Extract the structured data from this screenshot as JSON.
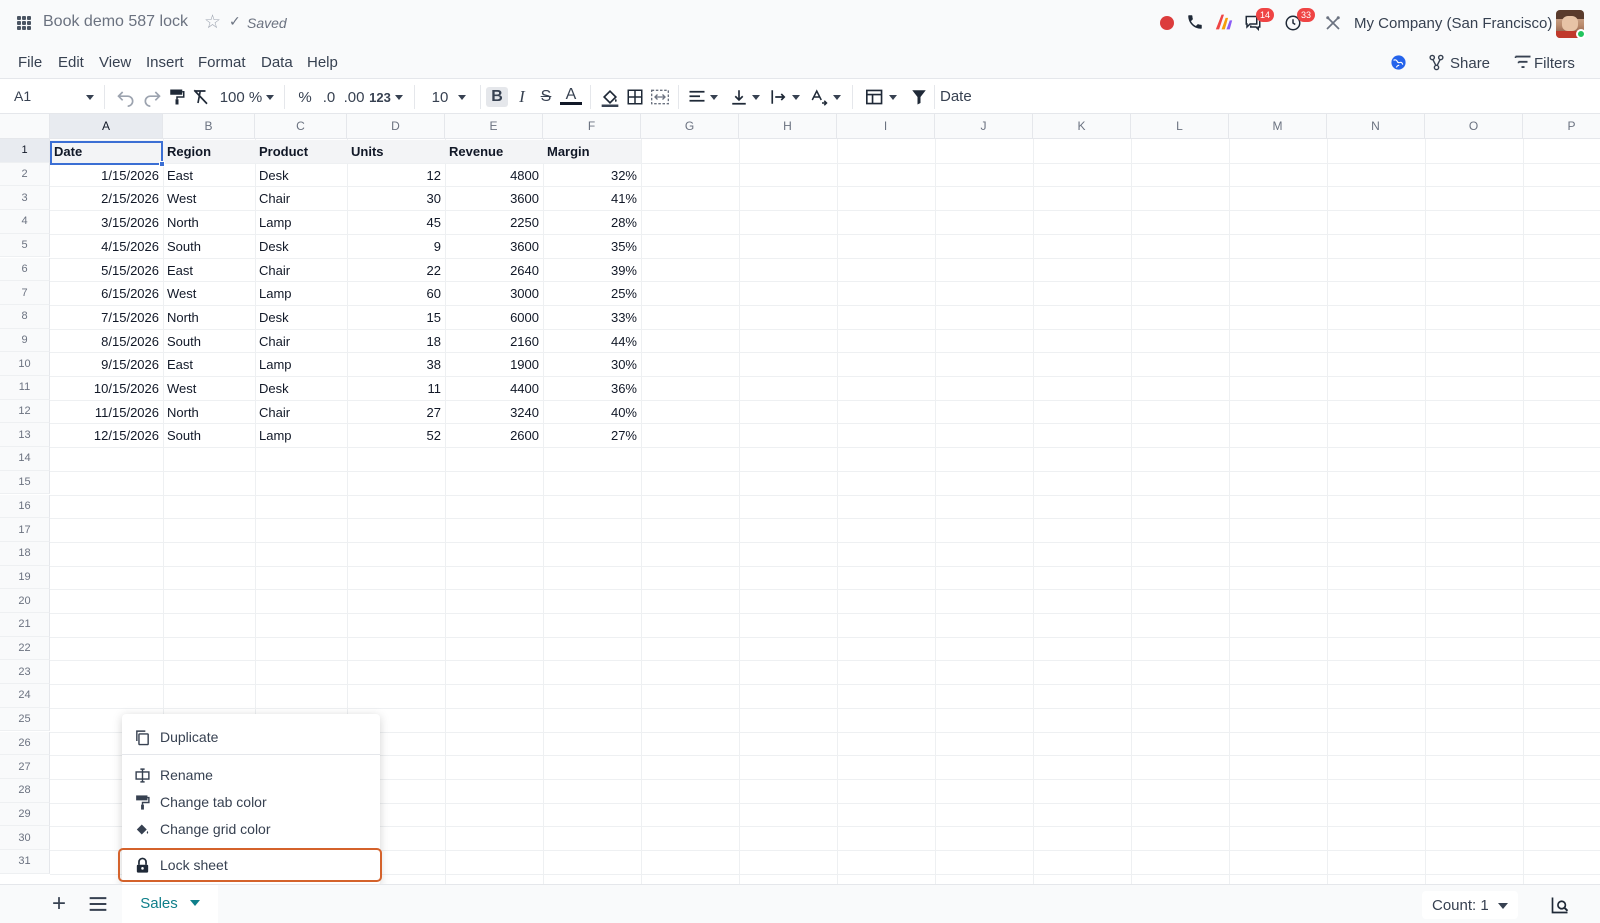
{
  "header": {
    "doc_title": "Book demo 587 lock",
    "saved_label": "Saved",
    "chat_badge": "14",
    "activity_badge": "33",
    "company_name": "My Company (San Francisco)"
  },
  "menus": [
    "File",
    "Edit",
    "View",
    "Insert",
    "Format",
    "Data",
    "Help"
  ],
  "actions": {
    "share_label": "Share",
    "filters_label": "Filters"
  },
  "toolbar": {
    "cell_ref": "A1",
    "zoom": "100 %",
    "percent_label": "%",
    "decrease_decimals_label": ".0",
    "increase_decimals_label": ".00",
    "number_format_label": "123",
    "font_size": "10",
    "bold_label": "B",
    "italic_label": "I",
    "strike_label": "S",
    "text_color_label": "A",
    "formula_value": "Date"
  },
  "grid": {
    "columns": [
      "A",
      "B",
      "C",
      "D",
      "E",
      "F",
      "G",
      "H",
      "I",
      "J",
      "K",
      "L",
      "M",
      "N",
      "O",
      "P"
    ],
    "row_numbers": [
      "1",
      "2",
      "3",
      "4",
      "5",
      "6",
      "7",
      "8",
      "9",
      "10",
      "11",
      "12",
      "13",
      "14",
      "15",
      "16",
      "17",
      "18",
      "19",
      "20",
      "21",
      "22",
      "23",
      "24",
      "25",
      "26",
      "27",
      "28",
      "29",
      "30",
      "31"
    ],
    "headers": [
      "Date",
      "Region",
      "Product",
      "Units",
      "Revenue",
      "Margin"
    ],
    "rows": [
      [
        "1/15/2026",
        "East",
        "Desk",
        "12",
        "4800",
        "32%"
      ],
      [
        "2/15/2026",
        "West",
        "Chair",
        "30",
        "3600",
        "41%"
      ],
      [
        "3/15/2026",
        "North",
        "Lamp",
        "45",
        "2250",
        "28%"
      ],
      [
        "4/15/2026",
        "South",
        "Desk",
        "9",
        "3600",
        "35%"
      ],
      [
        "5/15/2026",
        "East",
        "Chair",
        "22",
        "2640",
        "39%"
      ],
      [
        "6/15/2026",
        "West",
        "Lamp",
        "60",
        "3000",
        "25%"
      ],
      [
        "7/15/2026",
        "North",
        "Desk",
        "15",
        "6000",
        "33%"
      ],
      [
        "8/15/2026",
        "South",
        "Chair",
        "18",
        "2160",
        "44%"
      ],
      [
        "9/15/2026",
        "East",
        "Lamp",
        "38",
        "1900",
        "30%"
      ],
      [
        "10/15/2026",
        "West",
        "Desk",
        "11",
        "4400",
        "36%"
      ],
      [
        "11/15/2026",
        "North",
        "Chair",
        "27",
        "3240",
        "40%"
      ],
      [
        "12/15/2026",
        "South",
        "Lamp",
        "52",
        "2600",
        "27%"
      ]
    ],
    "selected_cell": "A1"
  },
  "context_menu": {
    "items": [
      {
        "label": "Duplicate",
        "icon": "duplicate-icon"
      },
      {
        "label": "Rename",
        "icon": "rename-icon"
      },
      {
        "label": "Change tab color",
        "icon": "paint-roller-icon"
      },
      {
        "label": "Change grid color",
        "icon": "paint-bucket-icon"
      },
      {
        "label": "Lock sheet",
        "icon": "lock-icon"
      }
    ],
    "highlighted": "Lock sheet"
  },
  "bottom": {
    "active_sheet": "Sales",
    "count_label": "Count: 1"
  },
  "colors": {
    "accent": "#0f7f8a",
    "selection": "#3b6fd4",
    "highlight_outline": "#d4622b",
    "badge": "#ef4444"
  }
}
